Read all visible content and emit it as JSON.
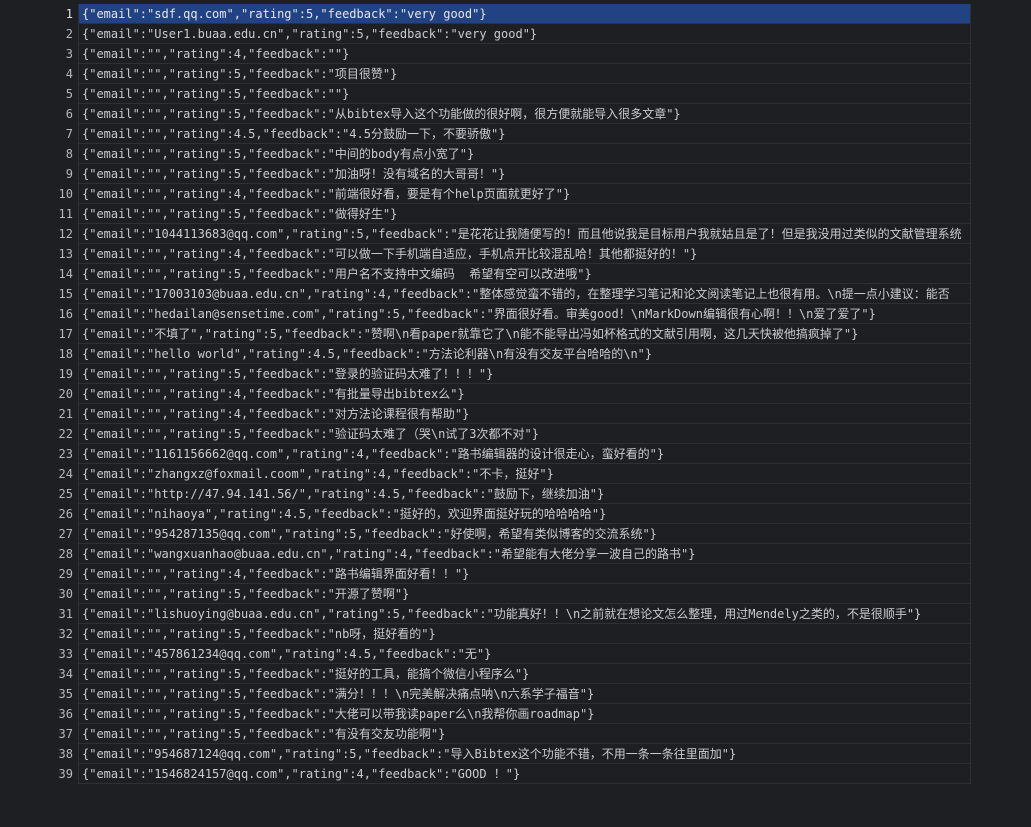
{
  "rows": [
    {
      "n": "1",
      "text": "{\"email\":\"sdf.qq.com\",\"rating\":5,\"feedback\":\"very good\"}"
    },
    {
      "n": "2",
      "text": "{\"email\":\"User1.buaa.edu.cn\",\"rating\":5,\"feedback\":\"very good\"}"
    },
    {
      "n": "3",
      "text": "{\"email\":\"\",\"rating\":4,\"feedback\":\"\"}"
    },
    {
      "n": "4",
      "text": "{\"email\":\"\",\"rating\":5,\"feedback\":\"项目很赞\"}"
    },
    {
      "n": "5",
      "text": "{\"email\":\"\",\"rating\":5,\"feedback\":\"\"}"
    },
    {
      "n": "6",
      "text": "{\"email\":\"\",\"rating\":5,\"feedback\":\"从bibtex导入这个功能做的很好啊，很方便就能导入很多文章\"}"
    },
    {
      "n": "7",
      "text": "{\"email\":\"\",\"rating\":4.5,\"feedback\":\"4.5分鼓励一下，不要骄傲\"}"
    },
    {
      "n": "8",
      "text": "{\"email\":\"\",\"rating\":5,\"feedback\":\"中间的body有点小宽了\"}"
    },
    {
      "n": "9",
      "text": "{\"email\":\"\",\"rating\":5,\"feedback\":\"加油呀！没有域名的大哥哥！\"}"
    },
    {
      "n": "10",
      "text": "{\"email\":\"\",\"rating\":4,\"feedback\":\"前端很好看，要是有个help页面就更好了\"}"
    },
    {
      "n": "11",
      "text": "{\"email\":\"\",\"rating\":5,\"feedback\":\"做得好生\"}"
    },
    {
      "n": "12",
      "text": "{\"email\":\"1044113683@qq.com\",\"rating\":5,\"feedback\":\"是花花让我随便写的！而且他说我是目标用户我就姑且是了！但是我没用过类似的文献管理系统"
    },
    {
      "n": "13",
      "text": "{\"email\":\"\",\"rating\":4,\"feedback\":\"可以做一下手机端自适应，手机点开比较混乱哈！其他都挺好的！\"}"
    },
    {
      "n": "14",
      "text": "{\"email\":\"\",\"rating\":5,\"feedback\":\"用户名不支持中文编码  希望有空可以改进哦\"}"
    },
    {
      "n": "15",
      "text": "{\"email\":\"17003103@buaa.edu.cn\",\"rating\":4,\"feedback\":\"整体感觉蛮不错的，在整理学习笔记和论文阅读笔记上也很有用。\\n提一点小建议：能否"
    },
    {
      "n": "16",
      "text": "{\"email\":\"hedailan@sensetime.com\",\"rating\":5,\"feedback\":\"界面很好看。审美good！\\nMarkDown编辑很有心啊！！\\n爱了爱了\"}"
    },
    {
      "n": "17",
      "text": "{\"email\":\"不填了\",\"rating\":5,\"feedback\":\"赞啊\\n看paper就靠它了\\n能不能导出冯如杯格式的文献引用啊，这几天快被他搞疯掉了\"}"
    },
    {
      "n": "18",
      "text": "{\"email\":\"hello world\",\"rating\":4.5,\"feedback\":\"方法论利器\\n有没有交友平台哈哈的\\n\"}"
    },
    {
      "n": "19",
      "text": "{\"email\":\"\",\"rating\":5,\"feedback\":\"登录的验证码太难了！！！\"}"
    },
    {
      "n": "20",
      "text": "{\"email\":\"\",\"rating\":4,\"feedback\":\"有批量导出bibtex么\"}"
    },
    {
      "n": "21",
      "text": "{\"email\":\"\",\"rating\":4,\"feedback\":\"对方法论课程很有帮助\"}"
    },
    {
      "n": "22",
      "text": "{\"email\":\"\",\"rating\":5,\"feedback\":\"验证码太难了（哭\\n试了3次都不对\"}"
    },
    {
      "n": "23",
      "text": "{\"email\":\"1161156662@qq.com\",\"rating\":4,\"feedback\":\"路书编辑器的设计很走心，蛮好看的\"}"
    },
    {
      "n": "24",
      "text": "{\"email\":\"zhangxz@foxmail.coom\",\"rating\":4,\"feedback\":\"不卡，挺好\"}"
    },
    {
      "n": "25",
      "text": "{\"email\":\"http://47.94.141.56/\",\"rating\":4.5,\"feedback\":\"鼓励下，继续加油\"}"
    },
    {
      "n": "26",
      "text": "{\"email\":\"nihaoya\",\"rating\":4.5,\"feedback\":\"挺好的，欢迎界面挺好玩的哈哈哈哈\"}"
    },
    {
      "n": "27",
      "text": "{\"email\":\"954287135@qq.com\",\"rating\":5,\"feedback\":\"好使啊，希望有类似博客的交流系统\"}"
    },
    {
      "n": "28",
      "text": "{\"email\":\"wangxuanhao@buaa.edu.cn\",\"rating\":4,\"feedback\":\"希望能有大佬分享一波自己的路书\"}"
    },
    {
      "n": "29",
      "text": "{\"email\":\"\",\"rating\":4,\"feedback\":\"路书编辑界面好看！！\"}"
    },
    {
      "n": "30",
      "text": "{\"email\":\"\",\"rating\":5,\"feedback\":\"开源了赞啊\"}"
    },
    {
      "n": "31",
      "text": "{\"email\":\"lishuoying@buaa.edu.cn\",\"rating\":5,\"feedback\":\"功能真好！！\\n之前就在想论文怎么整理，用过Mendely之类的，不是很顺手\"}"
    },
    {
      "n": "32",
      "text": "{\"email\":\"\",\"rating\":5,\"feedback\":\"nb呀，挺好看的\"}"
    },
    {
      "n": "33",
      "text": "{\"email\":\"457861234@qq.com\",\"rating\":4.5,\"feedback\":\"无\"}"
    },
    {
      "n": "34",
      "text": "{\"email\":\"\",\"rating\":5,\"feedback\":\"挺好的工具，能搞个微信小程序么\"}"
    },
    {
      "n": "35",
      "text": "{\"email\":\"\",\"rating\":5,\"feedback\":\"满分！！！\\n完美解决痛点呐\\n六系学子福音\"}"
    },
    {
      "n": "36",
      "text": "{\"email\":\"\",\"rating\":5,\"feedback\":\"大佬可以带我读paper么\\n我帮你画roadmap\"}"
    },
    {
      "n": "37",
      "text": "{\"email\":\"\",\"rating\":5,\"feedback\":\"有没有交友功能啊\"}"
    },
    {
      "n": "38",
      "text": "{\"email\":\"954687124@qq.com\",\"rating\":5,\"feedback\":\"导入Bibtex这个功能不错，不用一条一条往里面加\"}"
    },
    {
      "n": "39",
      "text": "{\"email\":\"1546824157@qq.com\",\"rating\":4,\"feedback\":\"GOOD ！\"}"
    }
  ]
}
